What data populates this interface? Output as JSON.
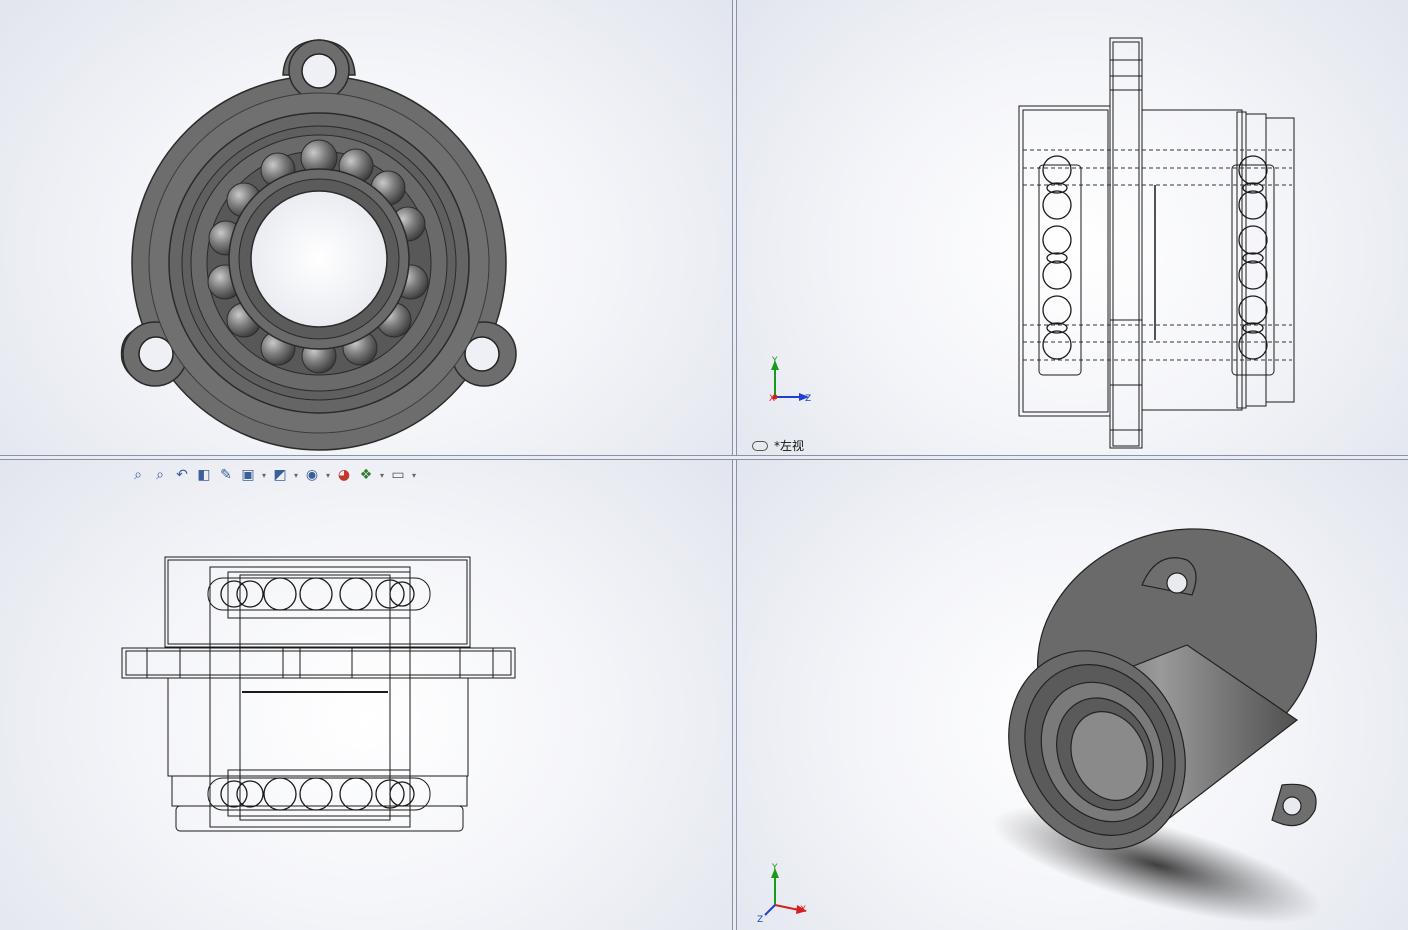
{
  "viewports": {
    "top_right": {
      "view_label": "*左视"
    }
  },
  "triad": {
    "x": "X",
    "y": "Y",
    "z": "Z"
  },
  "toolbar": {
    "buttons": [
      {
        "name": "zoom-to-fit-icon",
        "glyph": "🔍"
      },
      {
        "name": "zoom-to-area-icon",
        "glyph": "🔎"
      },
      {
        "name": "previous-view-icon",
        "glyph": "↶"
      },
      {
        "name": "section-view-icon",
        "glyph": "◧"
      },
      {
        "name": "dynamic-annotation-icon",
        "glyph": "✎"
      },
      {
        "name": "view-orientation-icon",
        "glyph": "⬚"
      },
      {
        "name": "display-style-icon",
        "glyph": "◩"
      },
      {
        "name": "hide-show-items-icon",
        "glyph": "◉"
      },
      {
        "name": "edit-appearance-icon",
        "glyph": "◕"
      },
      {
        "name": "apply-scene-icon",
        "glyph": "❖"
      },
      {
        "name": "view-settings-icon",
        "glyph": "▭"
      }
    ]
  },
  "colors": {
    "part_gray": "#6f6f6f",
    "part_dark": "#3d3d3d",
    "triad_x": "#d42020",
    "triad_y": "#1a9a1a",
    "triad_z": "#2040d0",
    "splitter": "#8a93a6"
  }
}
